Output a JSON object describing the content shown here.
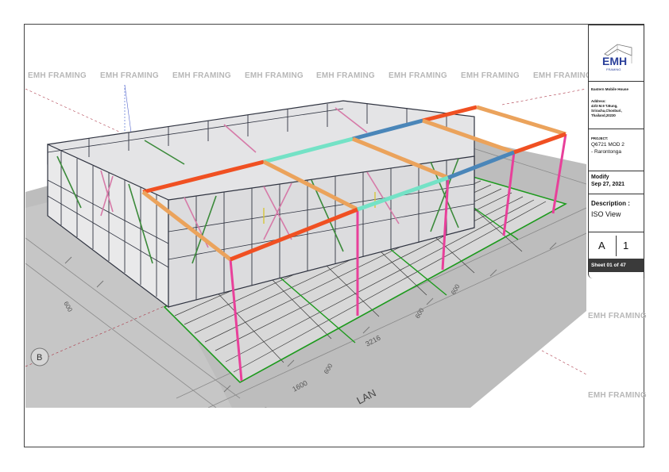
{
  "watermark": {
    "text": "EMH FRAMING",
    "instances_top": [
      "EMH FRAMING",
      "EMH FRAMING",
      "EMH FRAMING",
      "EMH FRAMING",
      "EMH FRAMING",
      "EMH FRAMING",
      "EMH FRAMING",
      "EMH FRAMING"
    ],
    "right_1": "EMH FRAMING",
    "right_2": "EMH FRAMING"
  },
  "title_block": {
    "logo_text": "EMH",
    "logo_sub": "FRAMING",
    "company": "Eastern Mobile House",
    "address_label": "Address:",
    "address_lines": [
      "43/3 M.9 T.Bung,",
      "Sriracha,Chonburi,",
      "Thailand,20230"
    ],
    "project_label": "PROJECT:",
    "project_lines": [
      "Q6721 MOD 2",
      "- Rarontonga"
    ],
    "modify_label": "Modify",
    "modify_date": "Sep 27, 2021",
    "description_label": "Description :",
    "description": "ISO View",
    "revision_letter": "A",
    "revision_number": "1",
    "sheet": "Sheet 01 of 47"
  },
  "drawing": {
    "dimension_labels": [
      "1600",
      "3216",
      "600",
      "600",
      "600",
      "600",
      "600"
    ],
    "grid_bubble": "B",
    "plan_text": "LAN",
    "colors": {
      "red_beam": "#f05022",
      "orange_beam": "#eba35c",
      "mint_beam": "#74e2c6",
      "blue_beam": "#4a86b9",
      "pink_post": "#e8409a",
      "floor_green": "#1e9a1e",
      "frame_dark": "#2f3340",
      "frame_pink": "#d67aa8",
      "frame_green": "#3b8a3a",
      "ground_grey": "#b9b9b9"
    }
  }
}
